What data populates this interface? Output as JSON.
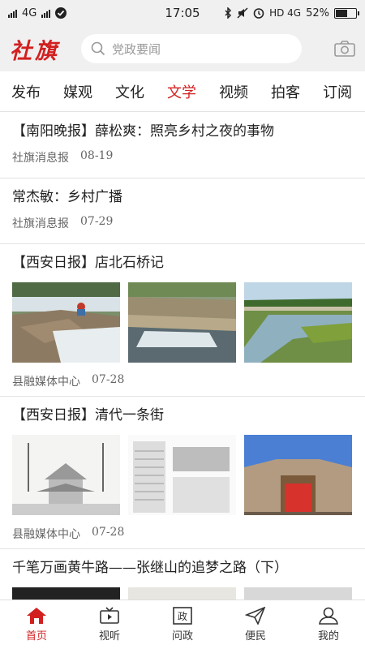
{
  "status_bar": {
    "network": "4G",
    "time": "17:05",
    "network_right": "HD 4G",
    "battery": "52%"
  },
  "header": {
    "logo": "社旗",
    "search_placeholder": "党政要闻"
  },
  "tabs": [
    "发布",
    "媒观",
    "文化",
    "文学",
    "视频",
    "拍客",
    "订阅"
  ],
  "active_tab_index": 3,
  "feed": [
    {
      "title": "【南阳晚报】薛松爽：照亮乡村之夜的事物",
      "source": "社旗消息报",
      "date": "08-19"
    },
    {
      "title": "常杰敏：乡村广播",
      "source": "社旗消息报",
      "date": "07-29"
    },
    {
      "title": "【西安日报】店北石桥记",
      "source": "县融媒体中心",
      "date": "07-28"
    },
    {
      "title": "【西安日报】清代一条街",
      "source": "县融媒体中心",
      "date": "07-28"
    },
    {
      "title": "千笔万画黄牛路——张继山的追梦之路（下）"
    }
  ],
  "bottom_nav": [
    "首页",
    "视听",
    "问政",
    "便民",
    "我的"
  ],
  "colors": {
    "accent": "#d21f1f",
    "background": "#f0f0f0"
  }
}
